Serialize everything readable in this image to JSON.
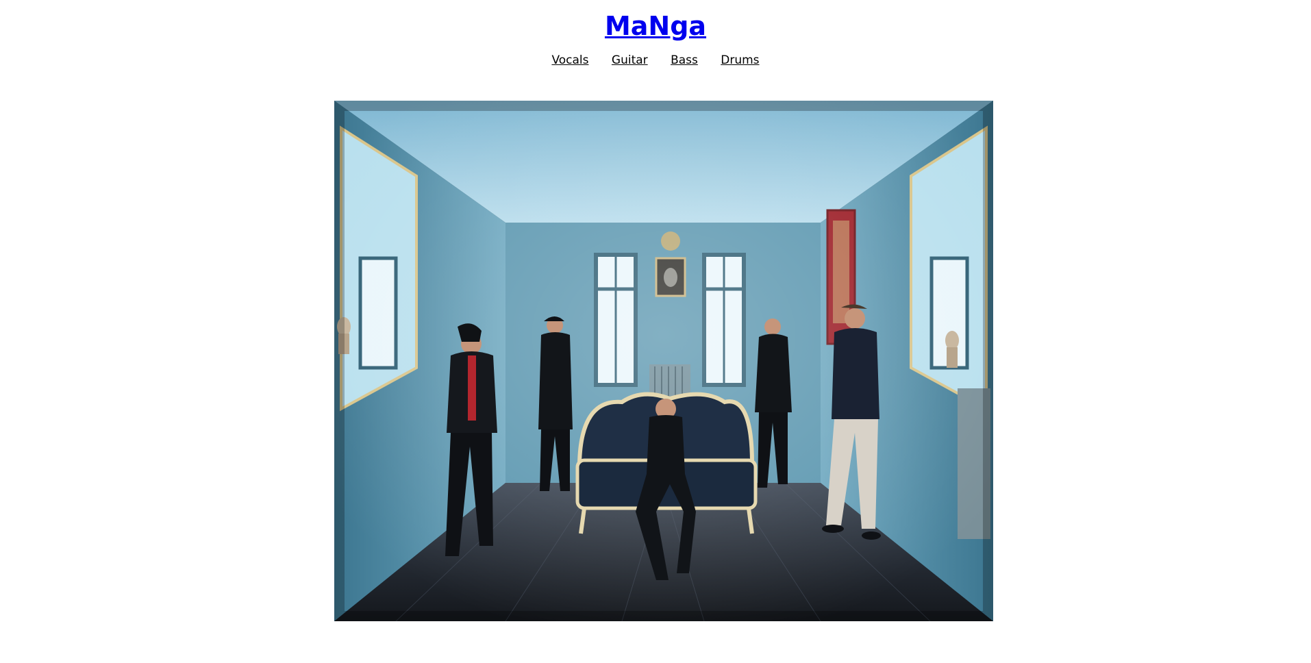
{
  "site": {
    "title": "MaNga"
  },
  "nav": {
    "items": [
      {
        "label": "Vocals"
      },
      {
        "label": "Guitar"
      },
      {
        "label": "Bass"
      },
      {
        "label": "Drums"
      }
    ]
  },
  "photo": {
    "icon": "band-photo",
    "colors": {
      "ceiling": "#a9d3e8",
      "walls": "#4d8ba6",
      "window": "#eaf6fb",
      "floor": "#2a2f38",
      "sofa": "#1f2f45",
      "clothing": "#111418",
      "accent_red": "#9b1b24"
    }
  }
}
